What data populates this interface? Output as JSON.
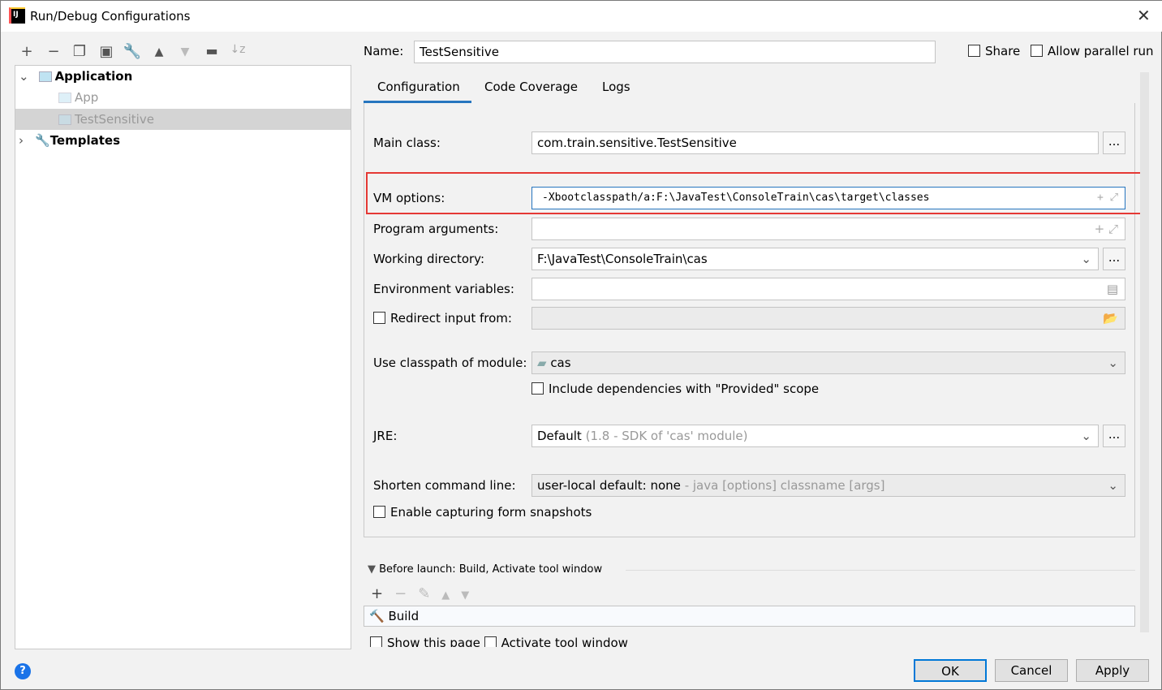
{
  "window": {
    "title": "Run/Debug Configurations",
    "logo": "IJ"
  },
  "toolbar": [
    "add-icon",
    "remove-icon",
    "copy-icon",
    "save-icon",
    "wrench-icon",
    "move-up-icon",
    "move-down-icon",
    "new-folder-icon",
    "sort-icon"
  ],
  "tree": {
    "application": "Application",
    "app": "App",
    "test": "TestSensitive",
    "templates": "Templates"
  },
  "name_label": "Name:",
  "name_value": "TestSensitive",
  "share": "Share",
  "parallel": "Allow parallel run",
  "tabs": [
    "Configuration",
    "Code Coverage",
    "Logs"
  ],
  "form": {
    "main_class_label": "Main class:",
    "main_class": "com.train.sensitive.TestSensitive",
    "vm_label": "VM options:",
    "vm": "-Xbootclasspath/a:F:\\JavaTest\\ConsoleTrain\\cas\\target\\classes",
    "args_label": "Program arguments:",
    "args": "",
    "wd_label": "Working directory:",
    "wd": "F:\\JavaTest\\ConsoleTrain\\cas",
    "env_label": "Environment variables:",
    "env": "",
    "redirect_label": "Redirect input from:",
    "module_label": "Use classpath of module:",
    "module": "cas",
    "include_deps": "Include dependencies with \"Provided\" scope",
    "jre_label": "JRE:",
    "jre": "Default",
    "jre_hint": "(1.8 - SDK of 'cas' module)",
    "shorten_label": "Shorten command line:",
    "shorten": "user-local default: none",
    "shorten_hint": "- java [options] classname [args]",
    "snapshots": "Enable capturing form snapshots"
  },
  "before_launch": {
    "title": "Before launch: Build, Activate tool window",
    "item": "Build",
    "show_page": "Show this page",
    "activate": "Activate tool window"
  },
  "buttons": {
    "ok": "OK",
    "cancel": "Cancel",
    "apply": "Apply",
    "help": "?"
  },
  "accent": "#2675bf",
  "highlight": "#e53935"
}
